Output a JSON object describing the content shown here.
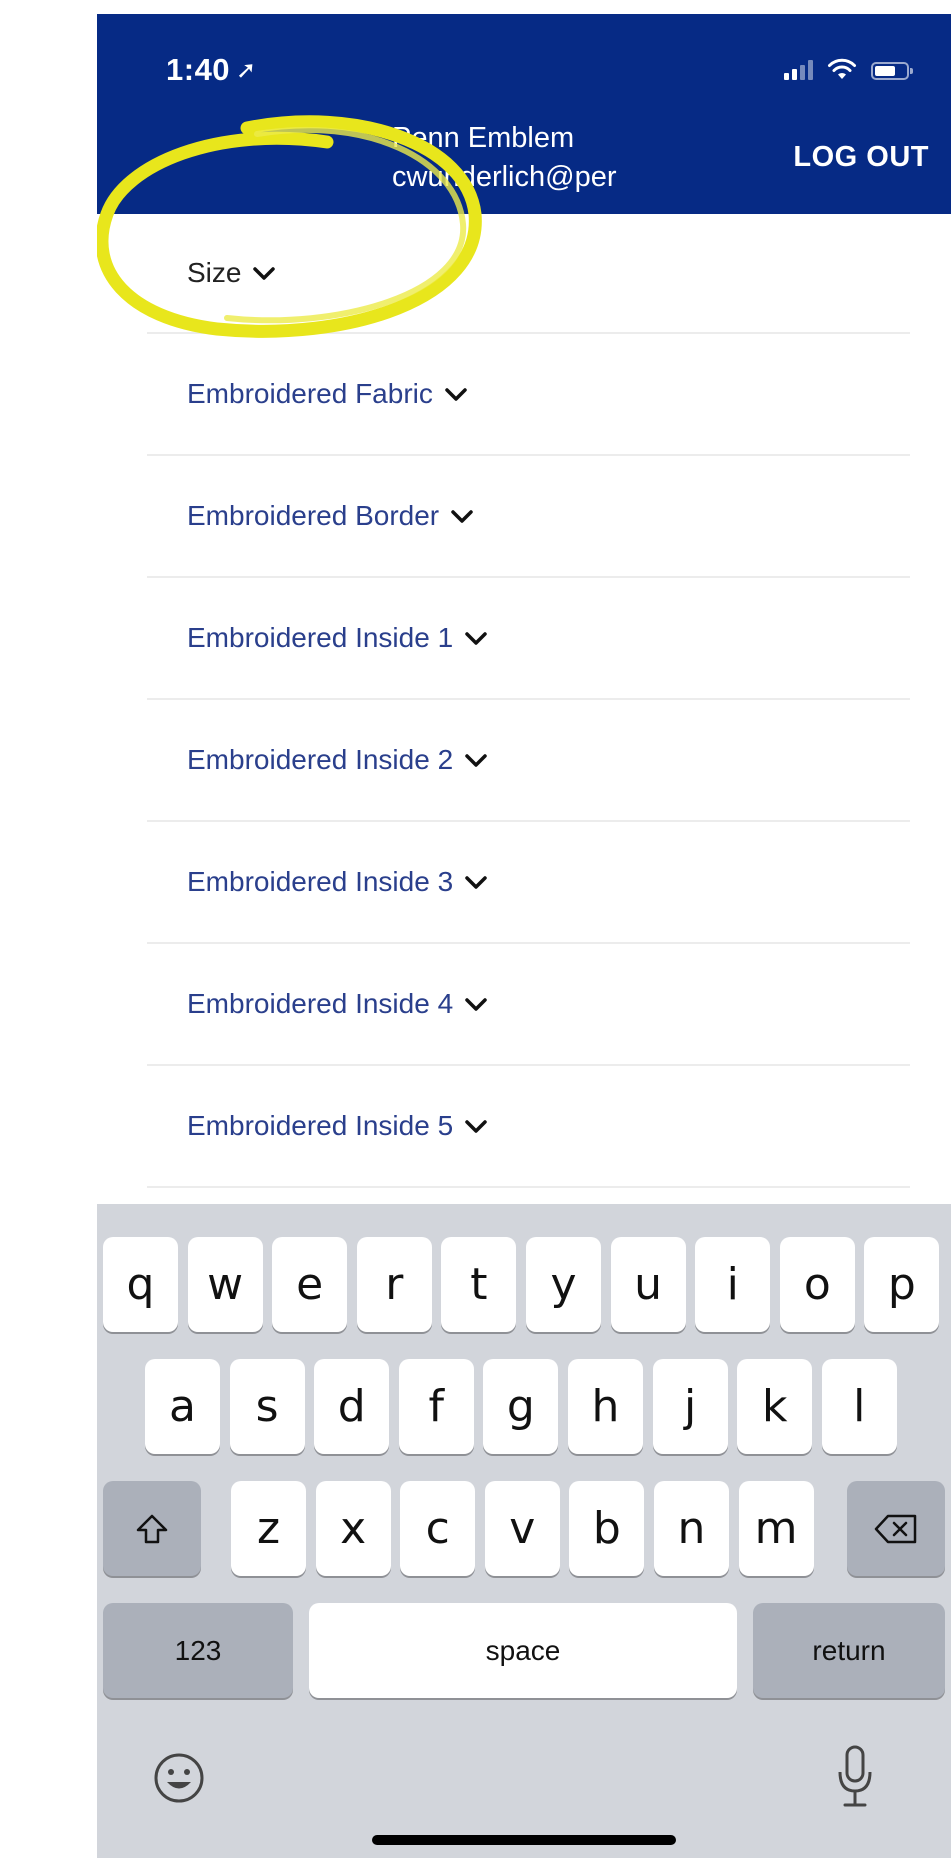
{
  "status_bar": {
    "time": "1:40",
    "location_icon": "location-arrow-icon",
    "signal_icon": "cellular-signal-icon",
    "wifi_icon": "wifi-icon",
    "battery_icon": "battery-icon"
  },
  "header": {
    "user_name": "Penn Emblem",
    "user_email": "cwunderlich@per",
    "logout_label": "LOG OUT",
    "background_color": "#062a85"
  },
  "filters": [
    {
      "label": "Size"
    },
    {
      "label": "Embroidered Fabric"
    },
    {
      "label": "Embroidered Border"
    },
    {
      "label": "Embroidered Inside 1"
    },
    {
      "label": "Embroidered Inside 2"
    },
    {
      "label": "Embroidered Inside 3"
    },
    {
      "label": "Embroidered Inside 4"
    },
    {
      "label": "Embroidered Inside 5"
    }
  ],
  "highlight_color": "#e8e61c",
  "keyboard": {
    "row1": [
      "q",
      "w",
      "e",
      "r",
      "t",
      "y",
      "u",
      "i",
      "o",
      "p"
    ],
    "row2": [
      "a",
      "s",
      "d",
      "f",
      "g",
      "h",
      "j",
      "k",
      "l"
    ],
    "row3": [
      "z",
      "x",
      "c",
      "v",
      "b",
      "n",
      "m"
    ],
    "numbers_label": "123",
    "space_label": "space",
    "return_label": "return",
    "shift_icon": "shift-icon",
    "delete_icon": "delete-icon",
    "emoji_icon": "emoji-icon",
    "mic_icon": "microphone-icon"
  }
}
